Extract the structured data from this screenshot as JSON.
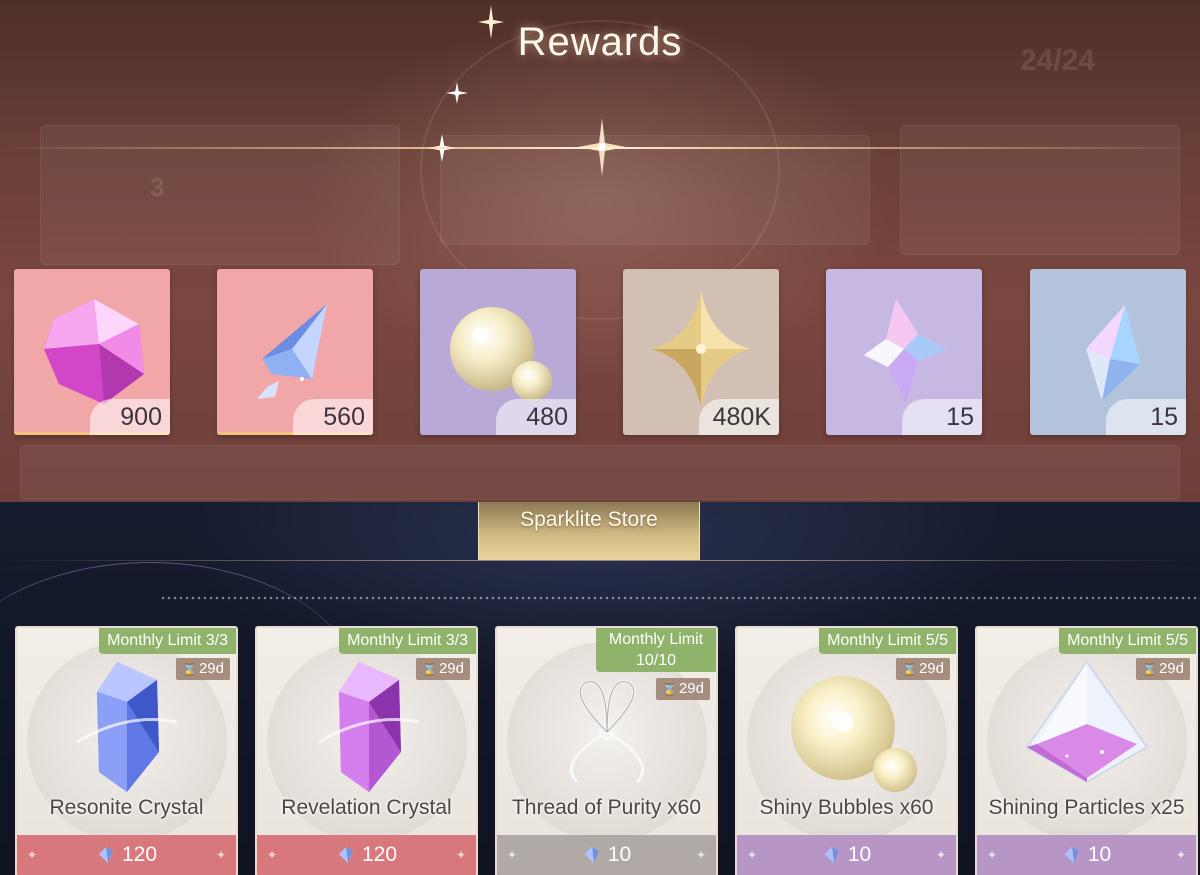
{
  "rewards_popup": {
    "title": "Rewards",
    "items": [
      {
        "id": "pink-crystal",
        "icon": "pink-faceted-crystal-icon",
        "qty": "900",
        "bg": "#f1a6a8"
      },
      {
        "id": "blue-shard",
        "icon": "blue-crystal-shard-icon",
        "qty": "560",
        "bg": "#f1a6a8"
      },
      {
        "id": "bubble",
        "icon": "shiny-bubble-icon",
        "qty": "480",
        "bg": "#b9a9d6"
      },
      {
        "id": "gold-star",
        "icon": "gold-four-point-star-icon",
        "qty": "480K",
        "bg": "#d2c0b4"
      },
      {
        "id": "prism-crystal",
        "icon": "prismatic-star-crystal-icon",
        "qty": "15",
        "bg": "#c6b8e3"
      },
      {
        "id": "ice-crystal",
        "icon": "clear-crystal-icon",
        "qty": "15",
        "bg": "#b3c3dc"
      }
    ]
  },
  "store": {
    "tab_label": "Sparklite Store",
    "items": [
      {
        "name": "Resonite Crystal",
        "limit": "Monthly Limit 3/3",
        "timer": "29d",
        "price": "120",
        "price_color": "#d9787c",
        "icon": "resonite-crystal-icon"
      },
      {
        "name": "Revelation Crystal",
        "limit": "Monthly Limit 3/3",
        "timer": "29d",
        "price": "120",
        "price_color": "#d9787c",
        "icon": "revelation-crystal-icon"
      },
      {
        "name": "Thread of Purity x60",
        "limit_line1": "Monthly Limit",
        "limit_line2": "10/10",
        "timer": "29d",
        "price": "10",
        "price_color": "#b1a9a5",
        "icon": "thread-of-purity-icon"
      },
      {
        "name": "Shiny Bubbles x60",
        "limit": "Monthly Limit 5/5",
        "timer": "29d",
        "price": "10",
        "price_color": "#b796c6",
        "icon": "shiny-bubbles-icon"
      },
      {
        "name": "Shining Particles x25",
        "limit": "Monthly Limit 5/5",
        "timer": "29d",
        "price": "10",
        "price_color": "#b796c6",
        "icon": "shining-particles-icon"
      }
    ]
  },
  "background": {
    "ghost_counter": "24/24",
    "ghost_small": "3"
  },
  "colors": {
    "accent_gold": "#e8d09a",
    "limit_green": "#8fb36a",
    "timer_brown": "#a58d7f"
  }
}
